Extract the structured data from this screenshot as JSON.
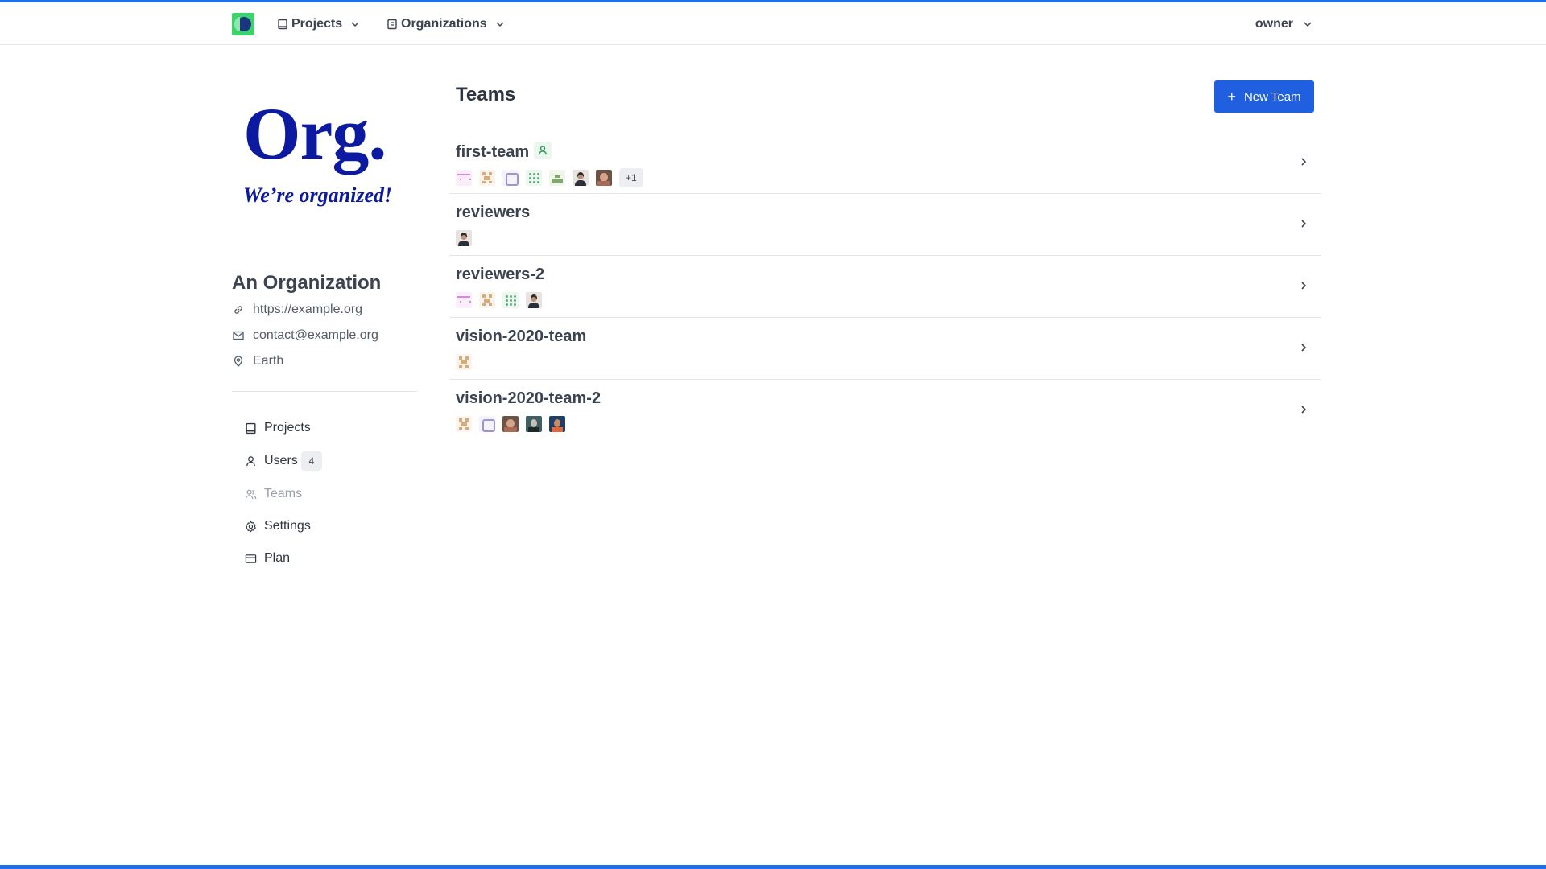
{
  "header": {
    "projects_label": "Projects",
    "organizations_label": "Organizations",
    "user_label": "owner"
  },
  "org": {
    "logo_text": "Org.",
    "logo_tagline": "We’re organized!",
    "name": "An Organization",
    "url": "https://example.org",
    "email": "contact@example.org",
    "location": "Earth"
  },
  "sidebar": {
    "items": [
      {
        "label": "Projects",
        "icon": "book-icon"
      },
      {
        "label": "Users",
        "icon": "user-icon",
        "count": "4"
      },
      {
        "label": "Teams",
        "icon": "team-icon",
        "active": true
      },
      {
        "label": "Settings",
        "icon": "gear-icon"
      },
      {
        "label": "Plan",
        "icon": "card-icon"
      }
    ]
  },
  "main": {
    "title": "Teams",
    "new_team_label": "New Team",
    "teams": [
      {
        "name": "first-team",
        "badge": "team-member-icon",
        "avatars": [
          "pink",
          "tan",
          "purple",
          "green",
          "olive",
          "photo1",
          "photo2"
        ],
        "more": "+1"
      },
      {
        "name": "reviewers",
        "avatars": [
          "photo1"
        ]
      },
      {
        "name": "reviewers-2",
        "avatars": [
          "pink",
          "tan",
          "green",
          "photo1"
        ]
      },
      {
        "name": "vision-2020-team",
        "avatars": [
          "tan"
        ]
      },
      {
        "name": "vision-2020-team-2",
        "avatars": [
          "tan",
          "purple",
          "photo2",
          "photo3",
          "photo4"
        ]
      }
    ]
  },
  "colors": {
    "accent": "#1f5fe0",
    "brand_green": "#3ad46b",
    "logo_blue": "#0b1aa0"
  }
}
